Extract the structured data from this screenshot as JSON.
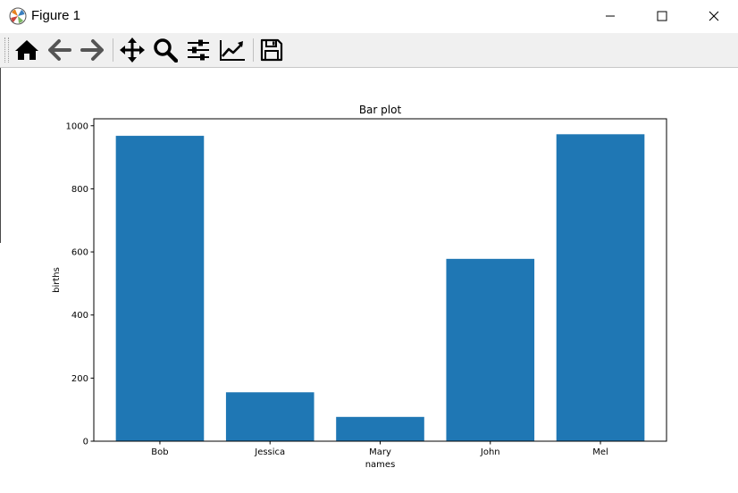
{
  "window": {
    "title": "Figure 1",
    "icon": "matplotlib-logo-icon",
    "controls": [
      "minimize-icon",
      "maximize-icon",
      "close-icon"
    ]
  },
  "toolbar": {
    "buttons": [
      "home-icon",
      "back-arrow-icon",
      "forward-arrow-icon",
      "pan-move-icon",
      "zoom-magnifier-icon",
      "configure-subplots-icon",
      "edit-axis-icon",
      "save-floppy-icon"
    ]
  },
  "colors": {
    "bar": "#1f77b4",
    "toolbar_bg": "#f0f0f0",
    "icon": "#000000"
  },
  "chart_data": {
    "type": "bar",
    "title": "Bar plot",
    "xlabel": "names",
    "ylabel": "births",
    "categories": [
      "Bob",
      "Jessica",
      "Mary",
      "John",
      "Mel"
    ],
    "values": [
      968,
      155,
      77,
      578,
      973
    ],
    "ylim": [
      0,
      1022
    ],
    "yticks": [
      0,
      200,
      400,
      600,
      800,
      1000
    ],
    "grid": false
  }
}
